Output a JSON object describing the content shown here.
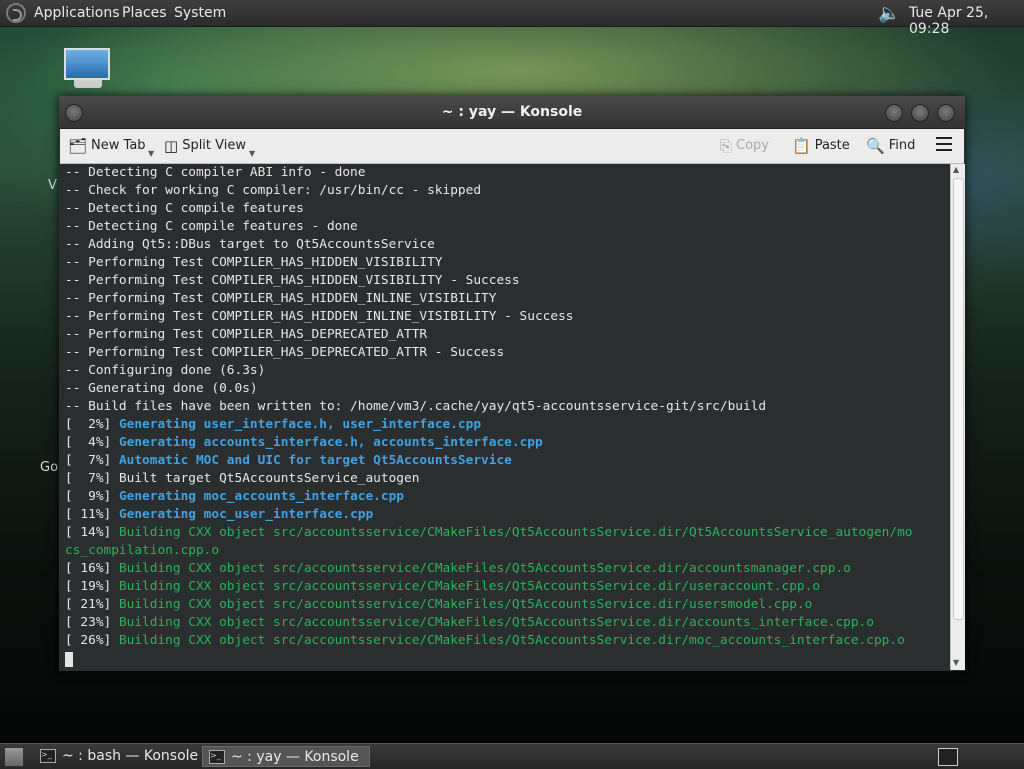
{
  "top_panel": {
    "menus": [
      "Applications",
      "Places",
      "System"
    ],
    "clock": "Tue Apr 25, 09:28",
    "volume_icon": "speaker-icon"
  },
  "desktop": {
    "icon_label_fragments": [
      "V",
      "Go"
    ]
  },
  "window": {
    "title": "~ : yay — Konsole",
    "toolbar": {
      "new_tab": "New Tab",
      "split_view": "Split View",
      "copy": "Copy",
      "paste": "Paste",
      "find": "Find"
    },
    "terminal": {
      "lines": [
        {
          "text": "-- Detecting C compiler ABI info - done",
          "style": "dim"
        },
        {
          "text": "-- Check for working C compiler: /usr/bin/cc - skipped",
          "style": "dim"
        },
        {
          "text": "-- Detecting C compile features",
          "style": "dim"
        },
        {
          "text": "-- Detecting C compile features - done",
          "style": "dim"
        },
        {
          "text": "-- Adding Qt5::DBus target to Qt5AccountsService",
          "style": "dim"
        },
        {
          "text": "-- Performing Test COMPILER_HAS_HIDDEN_VISIBILITY",
          "style": "dim"
        },
        {
          "text": "-- Performing Test COMPILER_HAS_HIDDEN_VISIBILITY - Success",
          "style": "dim"
        },
        {
          "text": "-- Performing Test COMPILER_HAS_HIDDEN_INLINE_VISIBILITY",
          "style": "dim"
        },
        {
          "text": "-- Performing Test COMPILER_HAS_HIDDEN_INLINE_VISIBILITY - Success",
          "style": "dim"
        },
        {
          "text": "-- Performing Test COMPILER_HAS_DEPRECATED_ATTR",
          "style": "dim"
        },
        {
          "text": "-- Performing Test COMPILER_HAS_DEPRECATED_ATTR - Success",
          "style": "dim"
        },
        {
          "text": "-- Configuring done (6.3s)",
          "style": "dim"
        },
        {
          "text": "-- Generating done (0.0s)",
          "style": "dim"
        },
        {
          "text": "-- Build files have been written to: /home/vm3/.cache/yay/qt5-accountsservice-git/src/build",
          "style": "dim"
        },
        {
          "prefix": "[  2%] ",
          "text": "Generating user_interface.h, user_interface.cpp",
          "style": "blue"
        },
        {
          "prefix": "[  4%] ",
          "text": "Generating accounts_interface.h, accounts_interface.cpp",
          "style": "blue"
        },
        {
          "prefix": "[  7%] ",
          "text": "Automatic MOC and UIC for target Qt5AccountsService",
          "style": "blue"
        },
        {
          "prefix": "[  7%] ",
          "text": "Built target Qt5AccountsService_autogen",
          "style": "dim"
        },
        {
          "prefix": "[  9%] ",
          "text": "Generating moc_accounts_interface.cpp",
          "style": "blue"
        },
        {
          "prefix": "[ 11%] ",
          "text": "Generating moc_user_interface.cpp",
          "style": "blue"
        },
        {
          "prefix": "[ 14%] ",
          "text": "Building CXX object src/accountsservice/CMakeFiles/Qt5AccountsService.dir/Qt5AccountsService_autogen/mo",
          "style": "green"
        },
        {
          "prefix": "",
          "text": "cs_compilation.cpp.o",
          "style": "green"
        },
        {
          "prefix": "[ 16%] ",
          "text": "Building CXX object src/accountsservice/CMakeFiles/Qt5AccountsService.dir/accountsmanager.cpp.o",
          "style": "green"
        },
        {
          "prefix": "[ 19%] ",
          "text": "Building CXX object src/accountsservice/CMakeFiles/Qt5AccountsService.dir/useraccount.cpp.o",
          "style": "green"
        },
        {
          "prefix": "[ 21%] ",
          "text": "Building CXX object src/accountsservice/CMakeFiles/Qt5AccountsService.dir/usersmodel.cpp.o",
          "style": "green"
        },
        {
          "prefix": "[ 23%] ",
          "text": "Building CXX object src/accountsservice/CMakeFiles/Qt5AccountsService.dir/accounts_interface.cpp.o",
          "style": "green"
        },
        {
          "prefix": "[ 26%] ",
          "text": "Building CXX object src/accountsservice/CMakeFiles/Qt5AccountsService.dir/moc_accounts_interface.cpp.o",
          "style": "green"
        }
      ]
    }
  },
  "taskbar": {
    "tasks": [
      {
        "label": "~ : bash — Konsole",
        "active": false
      },
      {
        "label": "~ : yay — Konsole",
        "active": true
      }
    ]
  }
}
